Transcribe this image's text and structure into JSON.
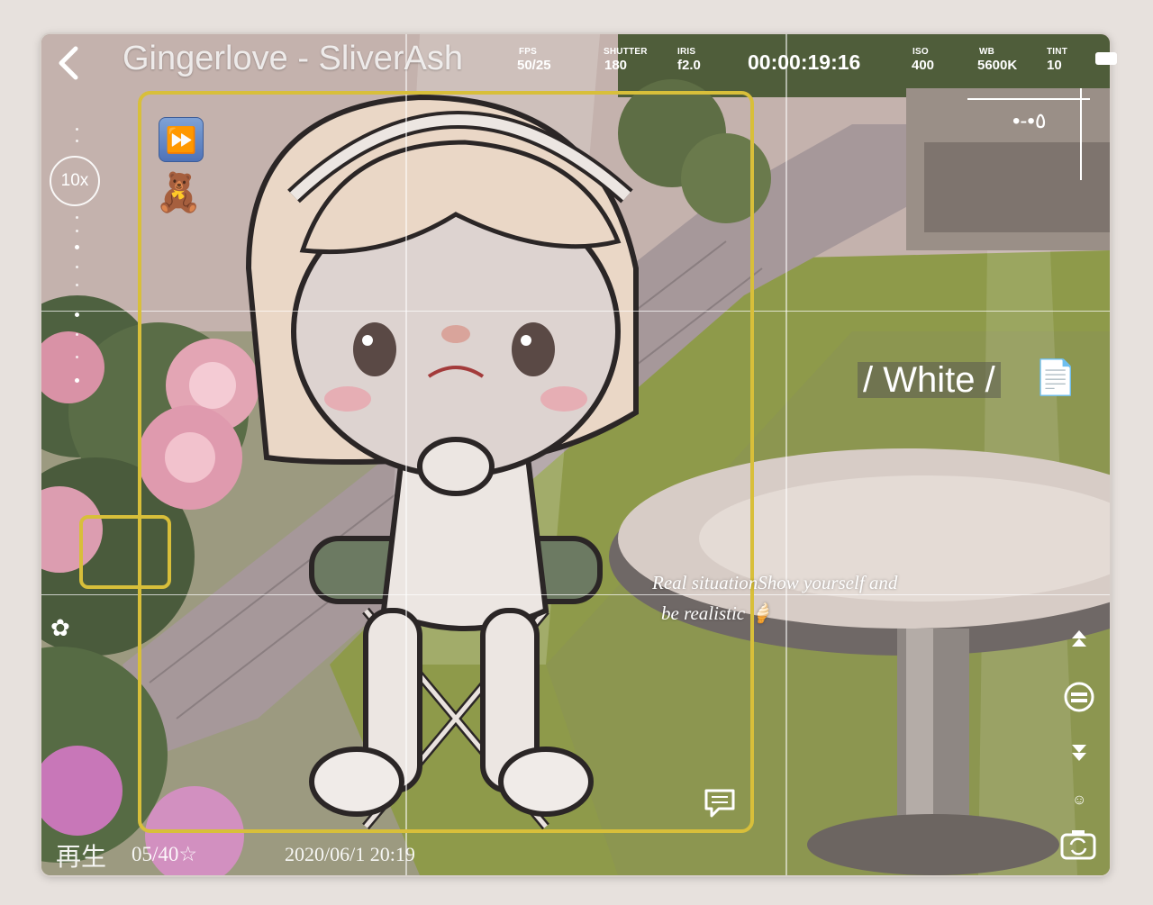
{
  "title": "Gingerlove - SliverAsh",
  "camera": {
    "fps_label": "FPS",
    "fps_value": "50/25",
    "shutter_label": "SHUTTER",
    "shutter_value": "180",
    "iris_label": "IRIS",
    "iris_value": "f2.0",
    "timecode": "00:00:19:16",
    "iso_label": "ISO",
    "iso_value": "400",
    "wb_label": "WB",
    "wb_value": "5600K",
    "tint_label": "TINT",
    "tint_value": "10"
  },
  "zoom": "10x",
  "signature": "•-•٥",
  "white_label": "/ White /",
  "caption_line1": "Real situationShow yourself and",
  "caption_line2": "be realistic 🍦",
  "playback_label": "再生",
  "frame_counter": "05/40☆",
  "datetime": "2020/06/1 20:19",
  "icons": {
    "back": "chevron-left-icon",
    "fast_forward": "fast-forward-icon",
    "teddy": "teddy-bear-icon",
    "document": "document-icon",
    "comment": "comment-icon",
    "scroll_up": "double-up-arrow-icon",
    "scroll_down": "double-down-arrow-icon",
    "menu": "menu-circle-icon",
    "camera_flip": "camera-flip-icon",
    "battery": "battery-icon",
    "flower": "flower-icon"
  },
  "colors": {
    "focus_frame": "#d8bf3a",
    "hud_text": "#ffffff"
  }
}
